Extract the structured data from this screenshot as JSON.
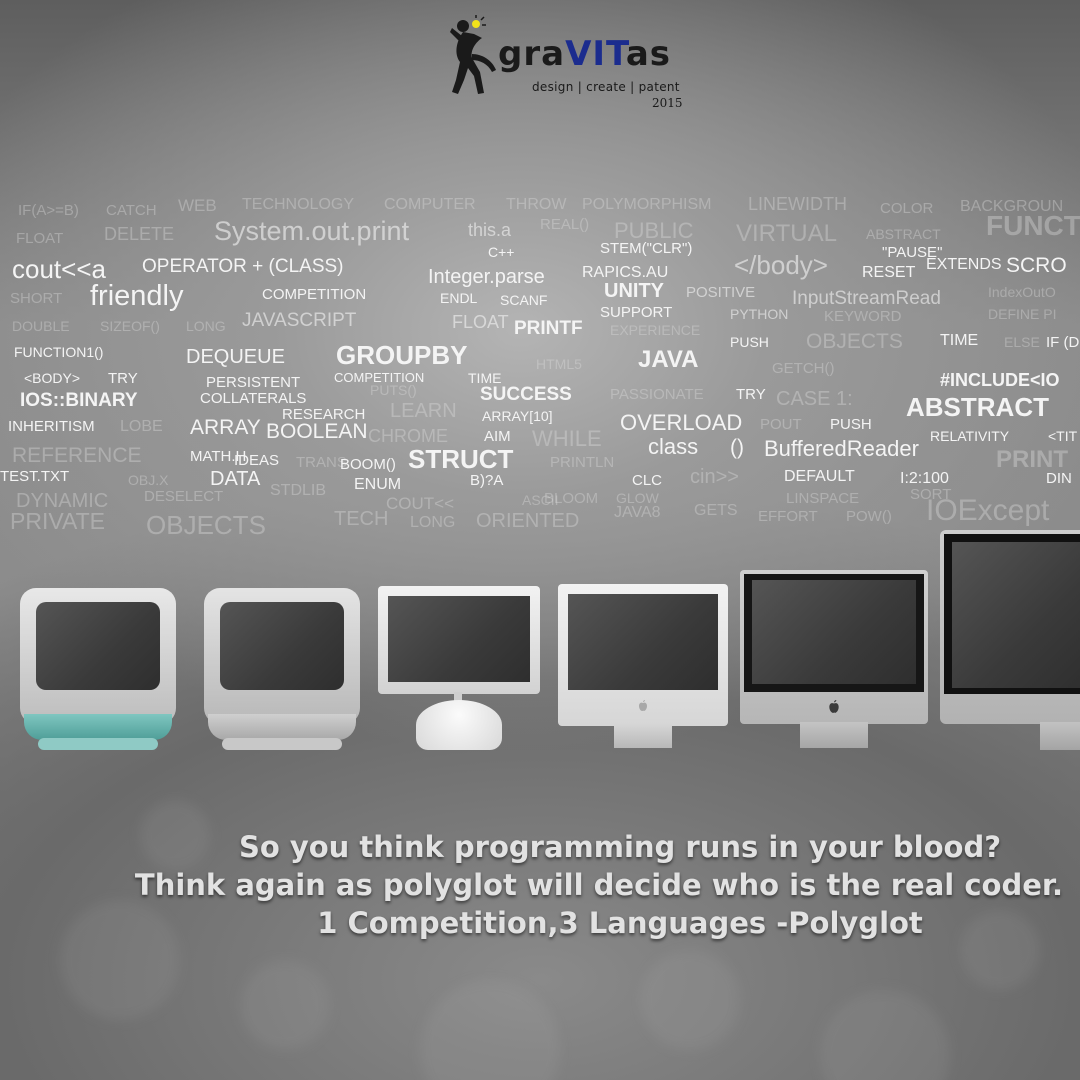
{
  "logo": {
    "wordmark_pre": "gra",
    "wordmark_vit": "VIT",
    "wordmark_post": "as",
    "tagline": "design | create | patent",
    "year": "2015"
  },
  "code_words": [
    "IF(A>=B)",
    "CATCH",
    "WEB",
    "TECHNOLOGY",
    "COMPUTER",
    "THROW",
    "POLYMORPHISM",
    "LINEWIDTH",
    "COLOR",
    "BACKGROUN",
    "FLOAT",
    "DELETE",
    "System.out.print",
    "this.a",
    "REAL()",
    "PUBLIC",
    "VIRTUAL",
    "ABSTRACT",
    "FUNCT",
    "cout<<a",
    "OPERATOR + (CLASS)",
    "C++",
    "STEM(\"CLR\")",
    "\"PAUSE\"",
    "EXTENDS",
    "SCRO",
    "Integer.parse",
    "RAPICS.AU",
    "</body>",
    "RESET",
    "SHORT",
    "friendly",
    "COMPETITION",
    "ENDL",
    "SCANF",
    "UNITY",
    "POSITIVE",
    "InputStreamRead",
    "IndexOutO",
    "DOUBLE",
    "SIZEOF()",
    "LONG",
    "JAVASCRIPT",
    "FLOAT",
    "PRINTF",
    "SUPPORT",
    "PYTHON",
    "KEYWORD",
    "DEFINE PI",
    "EXPERIENCE",
    "FUNCTION1()",
    "DEQUEUE",
    "GROUPBY",
    "HTML5",
    "JAVA",
    "PUSH",
    "OBJECTS",
    "TIME",
    "ELSE",
    "IF (D",
    "<BODY>",
    "TRY",
    "PERSISTENT",
    "COMPETITION",
    "PUTS()",
    "TIME",
    "GETCH()",
    "#INCLUDE<IO",
    "IOS::BINARY",
    "COLLATERALS",
    "SUCCESS",
    "PASSIONATE",
    "TRY",
    "CASE 1:",
    "ABSTRACT",
    "INHERITISM",
    "LOBE",
    "ARRAY",
    "RESEARCH",
    "LEARN",
    "ARRAY[10]",
    "OVERLOAD",
    "POUT",
    "PUSH",
    "RELATIVITY",
    "<TIT",
    "BOOLEAN",
    "CHROME",
    "AIM",
    "WHILE",
    "class",
    "()",
    "BufferedReader",
    "REFERENCE",
    "MATH.H",
    "IDEAS",
    "TRANS",
    "BOOM()",
    "STRUCT",
    "PRINTLN",
    "cin>>",
    "PRINT",
    "TEST.TXT",
    "OBJ.X",
    "DATA",
    "STDLIB",
    "ENUM",
    "B)?A",
    "CLC",
    "DEFAULT",
    "I:2:100",
    "DIN",
    "DYNAMIC",
    "DESELECT",
    "COUT<<",
    "ASCII",
    "BLOOM",
    "GLOW",
    "LINSPACE",
    "SORT",
    "PRIVATE",
    "OBJECTS",
    "TECH",
    "LONG",
    "ORIENTED",
    "JAVA8",
    "GETS",
    "EFFORT",
    "POW()",
    "IOExcept"
  ],
  "tagline": {
    "line1": "So you think programming runs in your blood?",
    "line2": "Think again as polyglot will decide who is the real coder.",
    "line3": "1 Competition,3 Languages -Polyglot"
  },
  "colors": {
    "logo_dark": "#1a1a1a",
    "logo_accent": "#1b2c8e",
    "logo_bulb": "#f2e21a",
    "tagline_text": "#e2e2e2",
    "code_text": "#f4f4f4"
  },
  "icons": [
    "jumping-person-icon",
    "apple-logo-icon"
  ]
}
